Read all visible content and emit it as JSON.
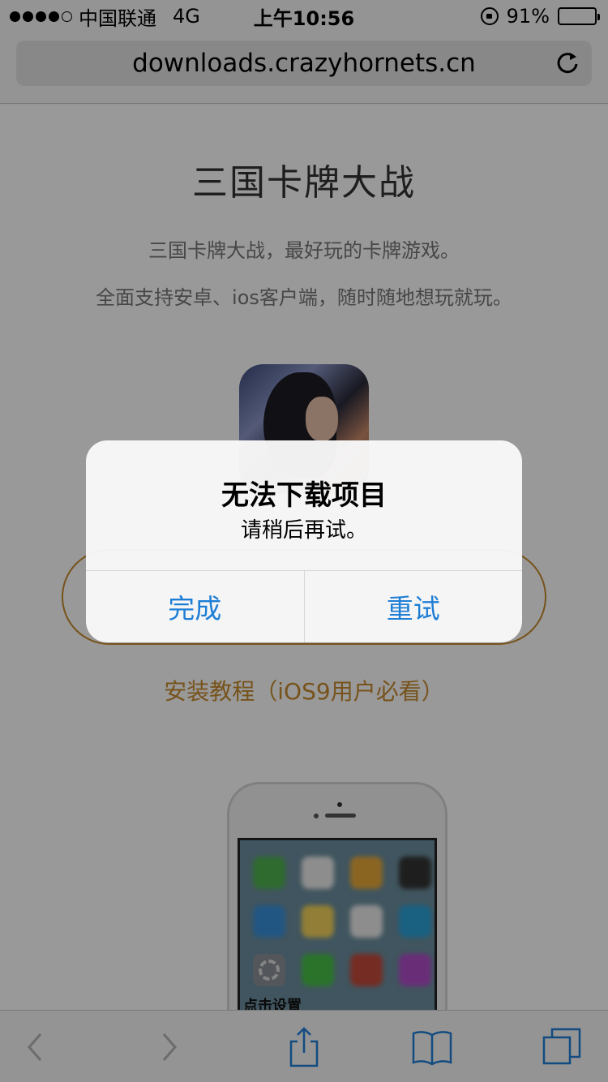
{
  "status_bar": {
    "carrier": "中国联通",
    "network": "4G",
    "time": "上午10:56",
    "battery": "91%",
    "battery_level": 0.91
  },
  "browser": {
    "url": "downloads.crazyhornets.cn",
    "icons": {
      "reload": "reload-icon",
      "back": "back-icon",
      "forward": "forward-icon",
      "share": "share-icon",
      "bookmarks": "bookmarks-icon",
      "tabs": "tabs-icon"
    }
  },
  "page": {
    "title": "三国卡牌大战",
    "description_line1": "三国卡牌大战，最好玩的卡牌游戏。",
    "description_line2": "全面支持安卓、ios客户端，随时随地想玩就玩。",
    "tutorial_link": "安装教程（iOS9用户必看）",
    "phone_screen_caption": "点击设置",
    "accent_color": "#c68a2e"
  },
  "alert": {
    "title": "无法下载项目",
    "message": "请稍后再试。",
    "buttons": [
      "完成",
      "重试"
    ],
    "button_color": "#1e7ed6"
  }
}
